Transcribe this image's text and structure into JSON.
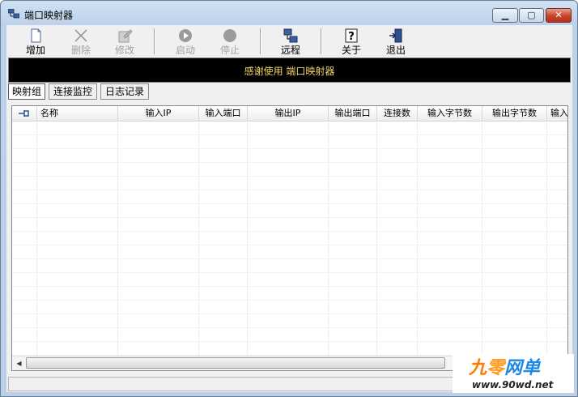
{
  "window": {
    "title": "端口映射器",
    "minimize_glyph": "▁",
    "maximize_glyph": "▢",
    "close_glyph": "✕"
  },
  "toolbar": {
    "buttons": [
      {
        "label": "增加",
        "icon": "new-document-icon",
        "enabled": true
      },
      {
        "label": "删除",
        "icon": "delete-x-icon",
        "enabled": false
      },
      {
        "label": "修改",
        "icon": "edit-icon",
        "enabled": false
      },
      {
        "label": "启动",
        "icon": "play-icon",
        "enabled": false
      },
      {
        "label": "停止",
        "icon": "stop-icon",
        "enabled": false
      },
      {
        "label": "远程",
        "icon": "remote-network-icon",
        "enabled": true
      },
      {
        "label": "关于",
        "icon": "help-icon",
        "enabled": true
      },
      {
        "label": "退出",
        "icon": "exit-door-icon",
        "enabled": true
      }
    ]
  },
  "banner": {
    "text": "感谢使用 端口映射器",
    "text_color": "#f3d66a"
  },
  "tabs": [
    {
      "label": "映射组",
      "active": true
    },
    {
      "label": "连接监控",
      "active": false
    },
    {
      "label": "日志记录",
      "active": false
    }
  ],
  "table": {
    "columns": [
      "名称",
      "输入IP",
      "输入端口",
      "输出IP",
      "输出端口",
      "连接数",
      "输入字节数",
      "输出字节数",
      "输入"
    ],
    "rows": []
  },
  "watermark": {
    "brand": "九零网单",
    "url": "www.90wd.net"
  }
}
